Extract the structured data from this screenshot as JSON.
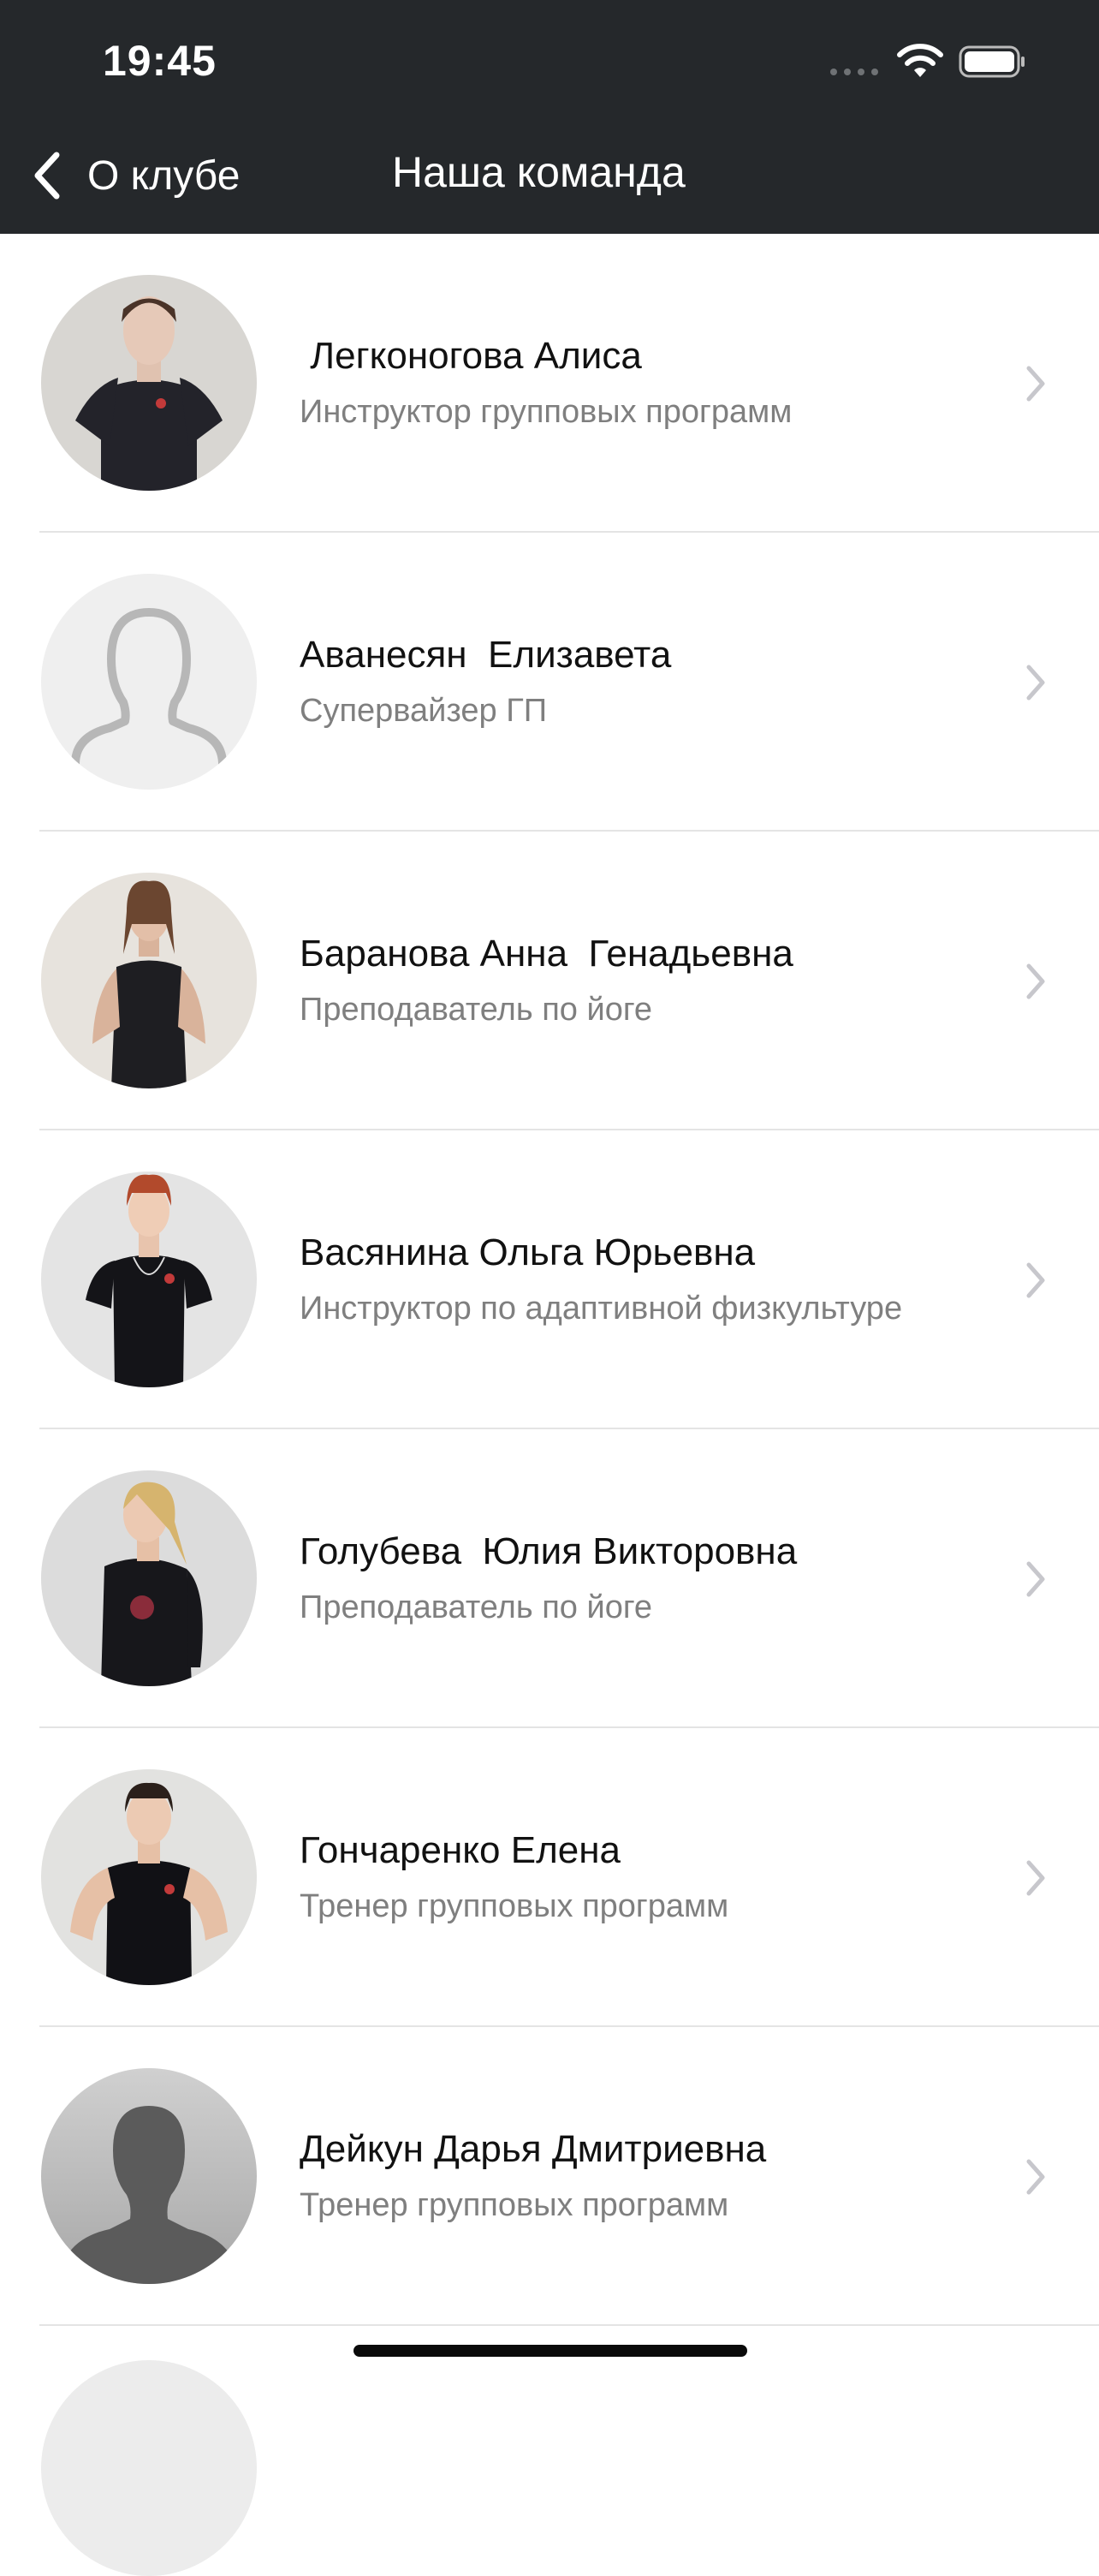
{
  "status_bar": {
    "time": "19:45"
  },
  "nav": {
    "back_label": "О клубе",
    "title": "Наша команда"
  },
  "team": [
    {
      "name": " Легконогова Алиса",
      "role": "Инструктор групповых программ",
      "avatar": "photo"
    },
    {
      "name": "Аванесян  Елизавета",
      "role": "Супервайзер ГП",
      "avatar": "placeholder-outline"
    },
    {
      "name": "Баранова Анна  Генадьевна",
      "role": "Преподаватель по йоге",
      "avatar": "photo"
    },
    {
      "name": "Васянина Ольга Юрьевна",
      "role": "Инструктор по адаптивной физкультуре",
      "avatar": "photo"
    },
    {
      "name": "Голубева  Юлия Викторовна",
      "role": "Преподаватель по йоге",
      "avatar": "photo"
    },
    {
      "name": "Гончаренко Елена",
      "role": "Тренер групповых программ",
      "avatar": "photo"
    },
    {
      "name": "Дейкун Дарья Дмитриевна",
      "role": "Тренер групповых программ",
      "avatar": "placeholder-silhouette"
    }
  ],
  "colors": {
    "header_bg": "#25282b",
    "divider": "#e4e4e4",
    "name_text": "#111111",
    "role_text": "#7f7f7f"
  }
}
